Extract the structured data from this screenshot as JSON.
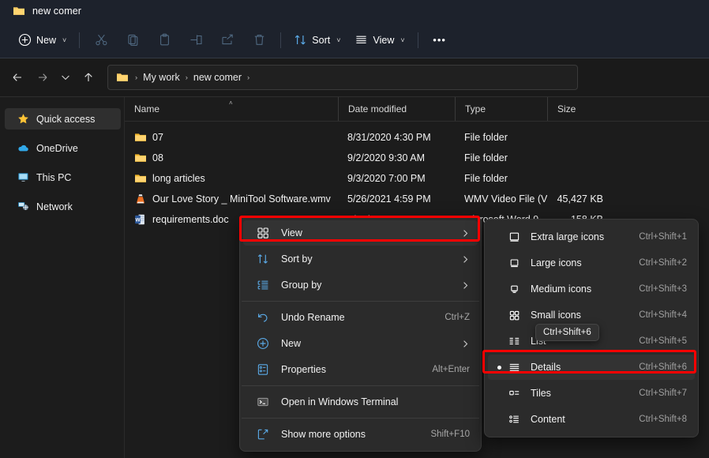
{
  "window": {
    "title": "new comer",
    "title_icon": "folder-icon"
  },
  "toolbar": {
    "new_label": "New",
    "new_icon": "plus-circle-icon",
    "cut_icon": "scissors-icon",
    "copy_icon": "copy-icon",
    "paste_icon": "clipboard-icon",
    "rename_icon": "rename-icon",
    "share_icon": "share-icon",
    "delete_icon": "trash-icon",
    "sort_label": "Sort",
    "sort_icon": "sort-arrows-icon",
    "view_label": "View",
    "view_icon": "list-lines-icon",
    "more_label": "•••",
    "chevron": "˅"
  },
  "address": {
    "back_icon": "arrow-left-icon",
    "forward_icon": "arrow-right-icon",
    "recent_icon": "chevron-down-icon",
    "up_icon": "arrow-up-icon",
    "folder_icon": "folder-icon",
    "separator": "›",
    "crumbs": [
      "My work",
      "new comer"
    ]
  },
  "sidebar": {
    "items": [
      {
        "label": "Quick access",
        "icon": "star-icon",
        "selected": true
      },
      {
        "label": "OneDrive",
        "icon": "cloud-icon",
        "selected": false
      },
      {
        "label": "This PC",
        "icon": "monitor-icon",
        "selected": false
      },
      {
        "label": "Network",
        "icon": "network-icon",
        "selected": false
      }
    ]
  },
  "filelist": {
    "columns": [
      {
        "label": "Name",
        "sorted": true,
        "sort_caret": "˄"
      },
      {
        "label": "Date modified",
        "sorted": false
      },
      {
        "label": "Type",
        "sorted": false
      },
      {
        "label": "Size",
        "sorted": false
      }
    ],
    "rows": [
      {
        "name": "07",
        "date": "8/31/2020 4:30 PM",
        "type": "File folder",
        "size": "",
        "icon": "folder-icon"
      },
      {
        "name": "08",
        "date": "9/2/2020 9:30 AM",
        "type": "File folder",
        "size": "",
        "icon": "folder-icon"
      },
      {
        "name": "long articles",
        "date": "9/3/2020 7:00 PM",
        "type": "File folder",
        "size": "",
        "icon": "folder-icon"
      },
      {
        "name": "Our Love Story _ MiniTool Software.wmv",
        "date": "5/26/2021 4:59 PM",
        "type": "WMV Video File (V...",
        "size": "45,427 KB",
        "icon": "vlc-cone-icon"
      },
      {
        "name": "requirements.doc",
        "date": "7/13/2020 3:16 PM",
        "type": "Microsoft Word 9...",
        "size": "158 KB",
        "icon": "word-doc-icon"
      }
    ]
  },
  "context_menu": {
    "items": [
      {
        "label": "View",
        "icon": "grid-four-icon",
        "accel": "",
        "submenu": true,
        "highlighted": true
      },
      {
        "label": "Sort by",
        "icon": "sort-arrows-icon",
        "accel": "",
        "submenu": true,
        "highlighted": false
      },
      {
        "label": "Group by",
        "icon": "group-list-icon",
        "accel": "",
        "submenu": true,
        "highlighted": false
      },
      {
        "separator": true
      },
      {
        "label": "Undo Rename",
        "icon": "undo-icon",
        "accel": "Ctrl+Z",
        "submenu": false,
        "highlighted": false
      },
      {
        "label": "New",
        "icon": "plus-circle-icon",
        "accel": "",
        "submenu": true,
        "highlighted": false
      },
      {
        "label": "Properties",
        "icon": "properties-icon",
        "accel": "Alt+Enter",
        "submenu": false,
        "highlighted": false
      },
      {
        "separator": true
      },
      {
        "label": "Open in Windows Terminal",
        "icon": "terminal-icon",
        "accel": "",
        "submenu": false,
        "highlighted": false
      },
      {
        "separator": true
      },
      {
        "label": "Show more options",
        "icon": "more-options-icon",
        "accel": "Shift+F10",
        "submenu": false,
        "highlighted": false
      }
    ]
  },
  "view_submenu": {
    "items": [
      {
        "label": "Extra large icons",
        "accel": "Ctrl+Shift+1",
        "icon": "xl-icon-view-icon",
        "checked": false
      },
      {
        "label": "Large icons",
        "accel": "Ctrl+Shift+2",
        "icon": "large-icon-view-icon",
        "checked": false
      },
      {
        "label": "Medium icons",
        "accel": "Ctrl+Shift+3",
        "icon": "medium-icon-view-icon",
        "checked": false
      },
      {
        "label": "Small icons",
        "accel": "Ctrl+Shift+4",
        "icon": "small-icon-view-icon",
        "checked": false
      },
      {
        "label": "List",
        "accel": "Ctrl+Shift+5",
        "icon": "list-view-icon",
        "checked": false
      },
      {
        "label": "Details",
        "accel": "Ctrl+Shift+6",
        "icon": "details-view-icon",
        "checked": true
      },
      {
        "label": "Tiles",
        "accel": "Ctrl+Shift+7",
        "icon": "tiles-view-icon",
        "checked": false
      },
      {
        "label": "Content",
        "accel": "Ctrl+Shift+8",
        "icon": "content-view-icon",
        "checked": false
      }
    ]
  },
  "tooltip": {
    "text": "Ctrl+Shift+6"
  },
  "annotations": {
    "highlight_color": "#ff0000",
    "boxes": [
      "view-menu-item",
      "details-submenu-item"
    ]
  }
}
